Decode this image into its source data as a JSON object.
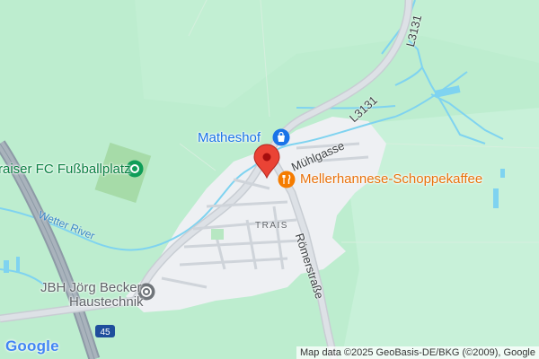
{
  "map": {
    "pois": {
      "matheshof": {
        "label": "Matheshof",
        "icon": "shopping-bag-icon"
      },
      "fussballplatz": {
        "label": "raiser FC Fußballplatz",
        "icon": "sports-icon"
      },
      "cafe": {
        "label": "Mellerhannese-Schoppekaffee",
        "icon": "restaurant-icon"
      },
      "jbh": {
        "label": "JBH Jörg Becker Haustechnik",
        "line1": "JBH Jörg Becker",
        "line2": "Haustechnik",
        "icon": "service-icon"
      }
    },
    "roads": {
      "muehlgasse": "Mühlgasse",
      "l3131_a": "L3131",
      "l3131_b": "L3131",
      "roemerstrasse": "Römerstraße",
      "highway_shield": "45"
    },
    "places": {
      "trais": "TRAIS"
    },
    "water": {
      "river": "Wetter River"
    },
    "marker": {
      "icon": "location-pin-icon"
    },
    "colors": {
      "land": "#e6f4ec",
      "forest": "#b9ebcc",
      "urban": "#eef0f3",
      "water": "#7fd3f0",
      "highway": "#8d9aa6",
      "poi_blue": "#1a73e8",
      "poi_green": "#0f9d58",
      "poi_orange": "#f57c00",
      "poi_gray": "#70757a",
      "marker": "#ea4335"
    }
  },
  "branding": {
    "logo": "Google"
  },
  "attribution": "Map data ©2025 GeoBasis-DE/BKG (©2009), Google"
}
